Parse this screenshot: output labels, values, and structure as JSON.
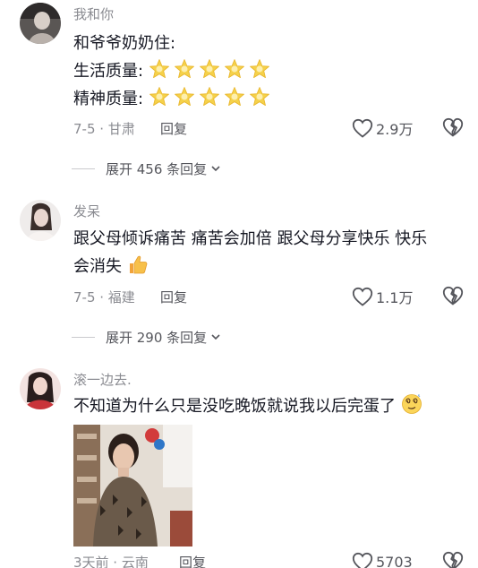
{
  "comments": [
    {
      "username": "我和你",
      "lines": [
        "和爷爷奶奶住:",
        "生活质量:",
        "精神质量:"
      ],
      "time_location": "7-5 · 甘肃",
      "reply_label": "回复",
      "like_count": "2.9万",
      "expand_label": "展开 456 条回复",
      "stars_per_rating": 5
    },
    {
      "username": "发呆",
      "lines": [
        "跟父母倾诉痛苦 痛苦会加倍 跟父母分享快乐 快乐",
        "会消失"
      ],
      "time_location": "7-5 · 福建",
      "reply_label": "回复",
      "like_count": "1.1万",
      "expand_label": "展开 290 条回复",
      "emoji": "thumbs-up"
    },
    {
      "username": "滚一边去.",
      "lines": [
        "不知道为什么只是没吃晚饭就说我以后完蛋了"
      ],
      "time_location": "3天前 · 云南",
      "reply_label": "回复",
      "like_count": "5703",
      "emoji": "dizzy-face",
      "has_image": true
    }
  ],
  "colors": {
    "text_primary": "#161823",
    "text_secondary": "#8a8b91",
    "star": "#f5d14a"
  }
}
